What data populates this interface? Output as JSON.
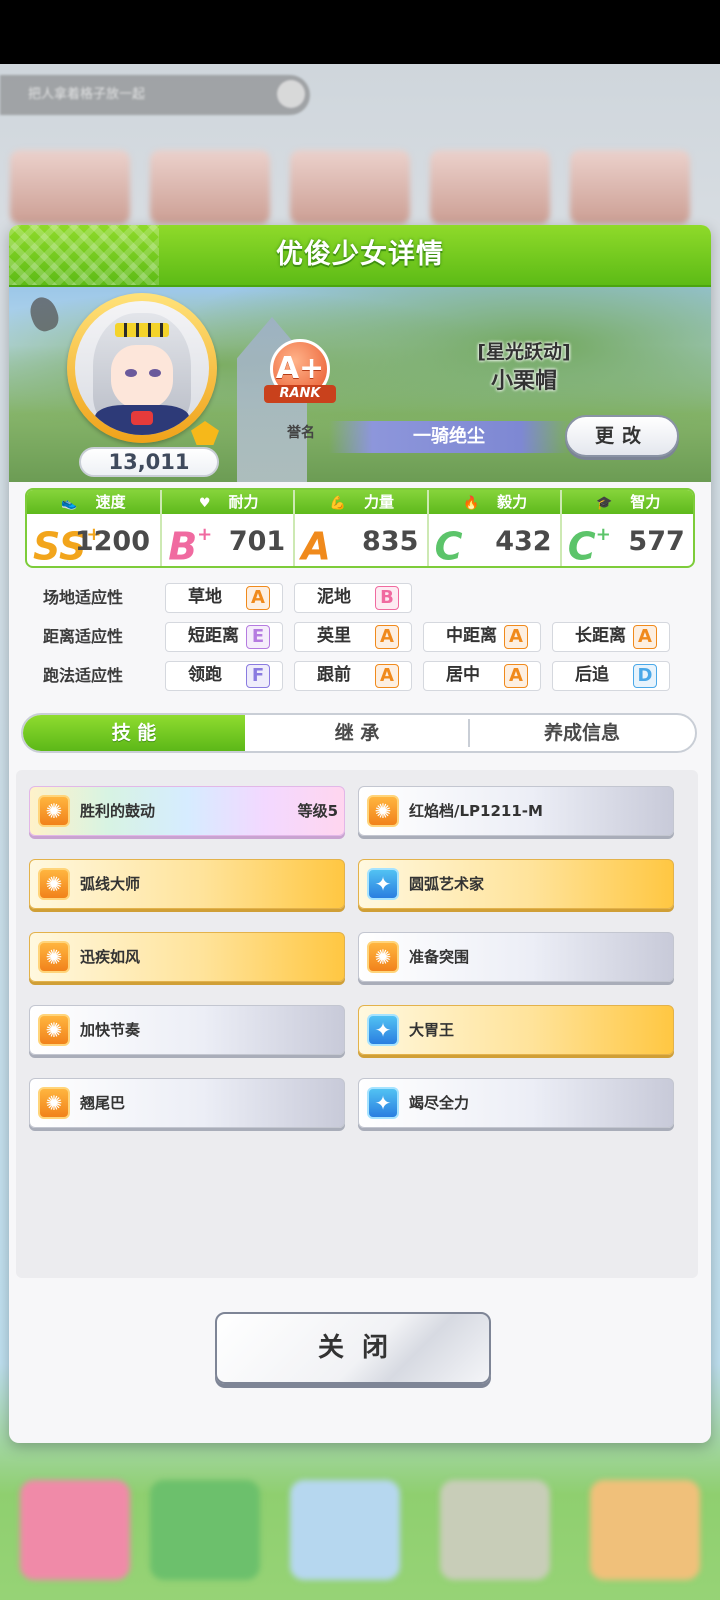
{
  "background": {
    "top_pill_text": "把人拿着格子放一起"
  },
  "panel": {
    "title": "优俊少女详情"
  },
  "character": {
    "fans": "13,011",
    "rank": "A+",
    "rank_ribbon": "RANK",
    "rank_caption": "誉名",
    "epithet": "[星光跃动]",
    "name": "小栗帽",
    "title": "一骑绝尘",
    "change_label": "更改"
  },
  "stats": [
    {
      "label": "速度",
      "icon": "shoe-icon",
      "grade": "SS",
      "plus": "+",
      "value": "1200",
      "color": "#f2a51c"
    },
    {
      "label": "耐力",
      "icon": "heart-icon",
      "grade": "B",
      "plus": "+",
      "value": "701",
      "color": "#f06aa0"
    },
    {
      "label": "力量",
      "icon": "muscle-icon",
      "grade": "A",
      "plus": "",
      "value": "835",
      "color": "#f08a1c"
    },
    {
      "label": "毅力",
      "icon": "flame-icon",
      "grade": "C",
      "plus": "",
      "value": "432",
      "color": "#5cc46a"
    },
    {
      "label": "智力",
      "icon": "grad-cap-icon",
      "grade": "C",
      "plus": "+",
      "value": "577",
      "color": "#5cc46a"
    }
  ],
  "aptitudes": {
    "track": {
      "label": "场地适应性",
      "items": [
        {
          "name": "草地",
          "grade": "A"
        },
        {
          "name": "泥地",
          "grade": "B"
        }
      ]
    },
    "distance": {
      "label": "距离适应性",
      "items": [
        {
          "name": "短距离",
          "grade": "E"
        },
        {
          "name": "英里",
          "grade": "A"
        },
        {
          "name": "中距离",
          "grade": "A"
        },
        {
          "name": "长距离",
          "grade": "A"
        }
      ]
    },
    "style": {
      "label": "跑法适应性",
      "items": [
        {
          "name": "领跑",
          "grade": "F"
        },
        {
          "name": "跟前",
          "grade": "A"
        },
        {
          "name": "居中",
          "grade": "A"
        },
        {
          "name": "后追",
          "grade": "D"
        }
      ]
    }
  },
  "grade_colors": {
    "A": "#f08a1c",
    "B": "#f06aa0",
    "C": "#5cc46a",
    "D": "#4aa8e8",
    "E": "#b57be0",
    "F": "#8a7be0"
  },
  "tabs": [
    {
      "label": "技 能",
      "active": true
    },
    {
      "label": "继 承",
      "active": false
    },
    {
      "label": "养成信息",
      "active": false
    }
  ],
  "skills": [
    {
      "name": "胜利的鼓动",
      "level": "等级5",
      "style": "rainbow",
      "icon": "orange"
    },
    {
      "name": "红焰档/LP1211-M",
      "level": "",
      "style": "white",
      "icon": "orange"
    },
    {
      "name": "弧线大师",
      "level": "",
      "style": "gold",
      "icon": "orange"
    },
    {
      "name": "圆弧艺术家",
      "level": "",
      "style": "gold",
      "icon": "blue"
    },
    {
      "name": "迅疾如风",
      "level": "",
      "style": "gold",
      "icon": "orange"
    },
    {
      "name": "准备突围",
      "level": "",
      "style": "white",
      "icon": "orange"
    },
    {
      "name": "加快节奏",
      "level": "",
      "style": "white",
      "icon": "orange"
    },
    {
      "name": "大胃王",
      "level": "",
      "style": "gold",
      "icon": "blue"
    },
    {
      "name": "翘尾巴",
      "level": "",
      "style": "white",
      "icon": "orange"
    },
    {
      "name": "竭尽全力",
      "level": "",
      "style": "white",
      "icon": "blue"
    }
  ],
  "close_label": "关闭"
}
